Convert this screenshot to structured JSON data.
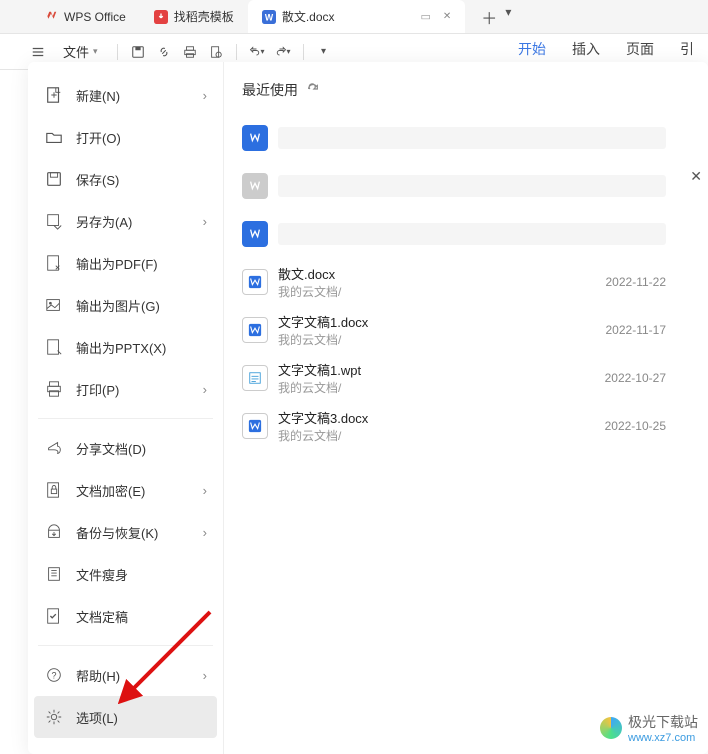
{
  "tabs": [
    {
      "label": "WPS Office",
      "kind": "wps"
    },
    {
      "label": "找稻壳模板",
      "kind": "duo"
    },
    {
      "label": "散文.docx",
      "kind": "doc",
      "active": true
    }
  ],
  "toolbar": {
    "file_label": "文件"
  },
  "ribbon": {
    "tabs": [
      "开始",
      "插入",
      "页面",
      "引"
    ],
    "active": "开始"
  },
  "filemenu": {
    "items": [
      {
        "icon": "new",
        "label": "新建(N)",
        "arrow": true
      },
      {
        "icon": "open",
        "label": "打开(O)"
      },
      {
        "icon": "save",
        "label": "保存(S)"
      },
      {
        "icon": "saveas",
        "label": "另存为(A)",
        "arrow": true
      },
      {
        "icon": "pdf",
        "label": "输出为PDF(F)"
      },
      {
        "icon": "img",
        "label": "输出为图片(G)"
      },
      {
        "icon": "ppt",
        "label": "输出为PPTX(X)"
      },
      {
        "icon": "print",
        "label": "打印(P)",
        "arrow": true
      },
      {
        "icon": "share",
        "label": "分享文档(D)"
      },
      {
        "icon": "lock",
        "label": "文档加密(E)",
        "arrow": true
      },
      {
        "icon": "backup",
        "label": "备份与恢复(K)",
        "arrow": true
      },
      {
        "icon": "slim",
        "label": "文件瘦身"
      },
      {
        "icon": "final",
        "label": "文档定稿"
      },
      {
        "icon": "help",
        "label": "帮助(H)",
        "arrow": true
      },
      {
        "icon": "gear",
        "label": "选项(L)",
        "selected": true
      }
    ]
  },
  "recent": {
    "heading": "最近使用",
    "files": [
      {
        "type": "doc-blue",
        "name": "",
        "path": "",
        "blank": true
      },
      {
        "type": "doc-grey",
        "name": "",
        "path": "",
        "blank": true
      },
      {
        "type": "doc-blue",
        "name": "",
        "path": "",
        "blank": true
      },
      {
        "type": "doc-outline",
        "name": "散文.docx",
        "path": "我的云文档/",
        "date": "2022-11-22"
      },
      {
        "type": "doc-outline",
        "name": "文字文稿1.docx",
        "path": "我的云文档/",
        "date": "2022-11-17"
      },
      {
        "type": "wpt",
        "name": "文字文稿1.wpt",
        "path": "我的云文档/",
        "date": "2022-10-27"
      },
      {
        "type": "doc-outline",
        "name": "文字文稿3.docx",
        "path": "我的云文档/",
        "date": "2022-10-25"
      }
    ]
  },
  "watermark": {
    "text": "极光下载站",
    "url": "www.xz7.com"
  }
}
